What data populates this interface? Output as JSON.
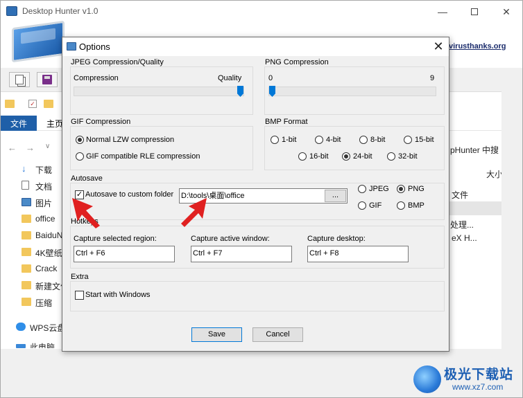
{
  "main": {
    "title": "Desktop Hunter v1.0",
    "link": "virusthanks.org"
  },
  "explorer": {
    "ribbon_file": "文件",
    "ribbon_home": "主页",
    "sidebar": [
      "下载",
      "文档",
      "图片",
      "office",
      "BaiduN",
      "4K壁纸",
      "Crack",
      "新建文件",
      "压缩",
      "WPS云盘",
      "此电脑"
    ],
    "right_texts": [
      "pHunter 中搜",
      "大小",
      "文件",
      "处理...",
      "eX H..."
    ]
  },
  "dialog": {
    "title": "Options",
    "jpeg": {
      "label": "JPEG Compression/Quality",
      "left": "Compression",
      "right": "Quality",
      "value_percent": 100
    },
    "png": {
      "label": "PNG Compression",
      "min": "0",
      "max": "9",
      "value": 0
    },
    "gif": {
      "label": "GIF Compression",
      "options": [
        "Normal LZW compression",
        "GIF compatible RLE compression"
      ],
      "selected": "Normal LZW compression"
    },
    "bmp": {
      "label": "BMP Format",
      "options": [
        "1-bit",
        "4-bit",
        "8-bit",
        "15-bit",
        "16-bit",
        "24-bit",
        "32-bit"
      ],
      "selected": "24-bit"
    },
    "autosave": {
      "label": "Autosave",
      "checkbox_label": "Autosave to custom folder",
      "checked": true,
      "folder": "D:\\tools\\桌面\\office",
      "browse": "...",
      "formats": [
        "JPEG",
        "PNG",
        "GIF",
        "BMP"
      ],
      "selected_format": "PNG"
    },
    "hotkeys": {
      "label": "Hotkeys",
      "region_label": "Capture selected region:",
      "region_value": "Ctrl + F6",
      "window_label": "Capture active window:",
      "window_value": "Ctrl + F7",
      "desktop_label": "Capture desktop:",
      "desktop_value": "Ctrl + F8"
    },
    "extra": {
      "label": "Extra",
      "start_label": "Start with Windows",
      "checked": false
    },
    "save": "Save",
    "cancel": "Cancel"
  },
  "watermark": {
    "text": "极光下载站",
    "url": "www.xz7.com"
  },
  "colors": {
    "accent": "#0078d7",
    "annotation": "#e02020",
    "ribbon": "#1f5fa8"
  }
}
